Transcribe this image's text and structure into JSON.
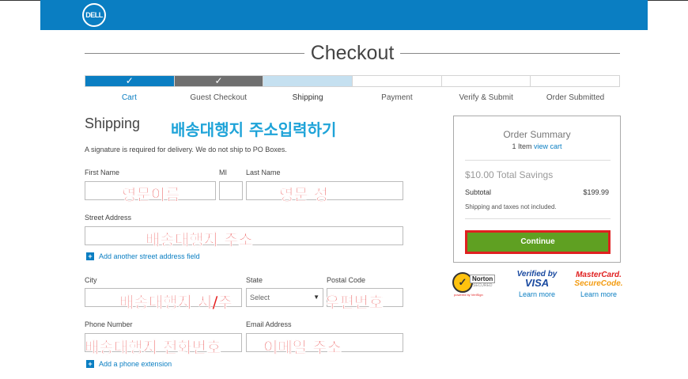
{
  "header": {
    "logo_text": "DELL",
    "brand_color": "#0a7ec2"
  },
  "page_title": "Checkout",
  "progress": {
    "segments": [
      {
        "state": "done",
        "color": "#0a7ec2",
        "mark": "✓"
      },
      {
        "state": "done",
        "color": "#6f6f6f",
        "mark": "✓"
      },
      {
        "state": "current",
        "color": "#c5e0f0",
        "mark": ""
      },
      {
        "state": "todo",
        "color": "#ffffff",
        "mark": ""
      },
      {
        "state": "todo",
        "color": "#ffffff",
        "mark": ""
      },
      {
        "state": "todo",
        "color": "#ffffff",
        "mark": ""
      }
    ],
    "steps": [
      "Cart",
      "Guest Checkout",
      "Shipping",
      "Payment",
      "Verify & Submit",
      "Order Submitted"
    ]
  },
  "shipping": {
    "heading": "Shipping",
    "note": "A signature is required for delivery. We do not ship to PO Boxes.",
    "labels": {
      "first_name": "First Name",
      "mi": "MI",
      "last_name": "Last Name",
      "street": "Street Address",
      "city": "City",
      "state": "State",
      "postal": "Postal Code",
      "phone": "Phone Number",
      "email": "Email Address"
    },
    "state_select": "Select",
    "add_street": "Add another street address field",
    "add_phone": "Add a phone extension"
  },
  "annotations": {
    "heading_ko": "배송대행지 주소입력하기",
    "first_name_ko": "영문이름",
    "last_name_ko": "영문 성",
    "street_ko": "배송대행지 주소",
    "city_state_ko": "배송대행지 시/주",
    "postal_ko": "우편번호",
    "phone_ko": "배송대행지 전화번호",
    "email_ko": "이메일 주소"
  },
  "summary": {
    "title": "Order Summary",
    "items": "1 Item",
    "view_cart": "view cart",
    "savings": "$10.00 Total Savings",
    "subtotal_label": "Subtotal",
    "subtotal_value": "$199.99",
    "tax_note": "Shipping and taxes not included.",
    "continue": "Continue"
  },
  "badges": {
    "norton": {
      "check": "✓",
      "name": "Norton",
      "secured": "SECURED",
      "powered": "powered by VeriSign"
    },
    "visa": {
      "line1": "Verified by",
      "line2": "VISA",
      "link": "Learn more"
    },
    "mastercard": {
      "line1": "MasterCard.",
      "line2": "SecureCode.",
      "link": "Learn more"
    }
  }
}
